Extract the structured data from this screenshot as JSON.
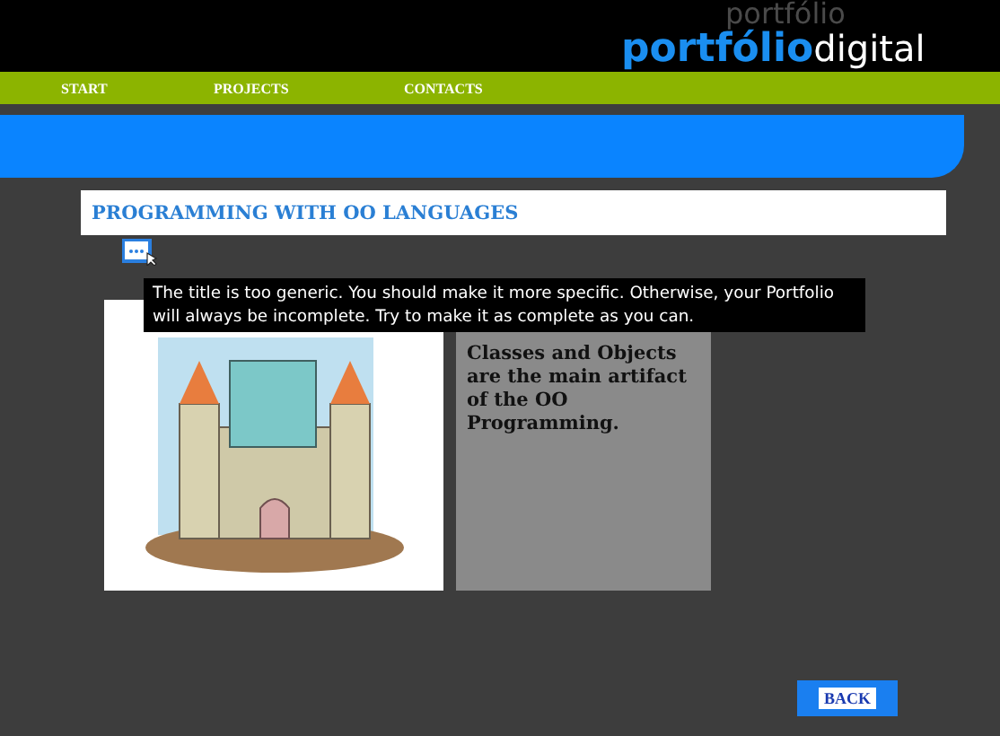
{
  "header": {
    "logo_backdrop": "portfólio",
    "logo_bold": "portfólio",
    "logo_light": "digital"
  },
  "nav": {
    "items": [
      "START",
      "PROJECTS",
      "CONTACTS"
    ]
  },
  "page_title": "PROGRAMMING WITH OO LANGUAGES",
  "tooltip": "The title is too generic. You should make it more specific. Otherwise, your Portfolio will always be incomplete. Try to make it as complete as you can.",
  "content": {
    "description": "Classes and Objects are the main artifact of the OO Programming."
  },
  "back_button": "BACK"
}
